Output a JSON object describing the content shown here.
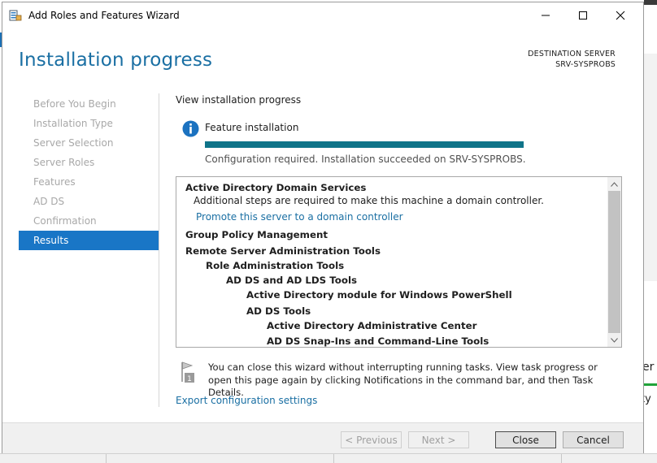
{
  "window": {
    "title": "Add Roles and Features Wizard"
  },
  "header": {
    "page_title": "Installation progress",
    "destination_label": "DESTINATION SERVER",
    "destination_server": "SRV-SYSPROBS"
  },
  "nav": {
    "items": [
      {
        "label": "Before You Begin",
        "active": false
      },
      {
        "label": "Installation Type",
        "active": false
      },
      {
        "label": "Server Selection",
        "active": false
      },
      {
        "label": "Server Roles",
        "active": false
      },
      {
        "label": "Features",
        "active": false
      },
      {
        "label": "AD DS",
        "active": false
      },
      {
        "label": "Confirmation",
        "active": false
      },
      {
        "label": "Results",
        "active": true
      }
    ]
  },
  "main": {
    "view_label": "View installation progress",
    "feature_label": "Feature installation",
    "progress": 1.0,
    "status_text": "Configuration required. Installation succeeded on SRV-SYSPROBS.",
    "results": [
      {
        "text": "Active Directory Domain Services",
        "style": "bold",
        "indent": 0
      },
      {
        "text": "Additional steps are required to make this machine a domain controller.",
        "style": "normal",
        "indent": 1
      },
      {
        "text": "Promote this server to a domain controller",
        "style": "link",
        "indent": 1
      },
      {
        "text": "Group Policy Management",
        "style": "bold",
        "indent": 0
      },
      {
        "text": "Remote Server Administration Tools",
        "style": "bold",
        "indent": 0
      },
      {
        "text": "Role Administration Tools",
        "style": "bold",
        "indent": 1
      },
      {
        "text": "AD DS and AD LDS Tools",
        "style": "bold",
        "indent": 2
      },
      {
        "text": "Active Directory module for Windows PowerShell",
        "style": "bold",
        "indent": 3
      },
      {
        "text": "AD DS Tools",
        "style": "bold",
        "indent": 3
      },
      {
        "text": "Active Directory Administrative Center",
        "style": "bold",
        "indent": 4
      },
      {
        "text": "AD DS Snap-Ins and Command-Line Tools",
        "style": "bold",
        "indent": 4
      }
    ],
    "note_icon_badge": "1",
    "note_text": "You can close this wizard without interrupting running tasks. View task progress or open this page again by clicking Notifications in the command bar, and then Task Details.",
    "export_link": "Export configuration settings"
  },
  "footer": {
    "previous_label": "< Previous",
    "next_label": "Next >",
    "close_label": "Close",
    "cancel_label": "Cancel"
  },
  "background": {
    "partial_text_1": "er",
    "partial_text_2": "ty"
  },
  "colors": {
    "accent": "#1a6fa3",
    "nav_active": "#1976c6",
    "progress": "#0f7489",
    "info_icon": "#1b72c0"
  },
  "icons": {
    "app": "server-manager-icon",
    "info": "info-icon",
    "note": "flag-notification-icon"
  }
}
